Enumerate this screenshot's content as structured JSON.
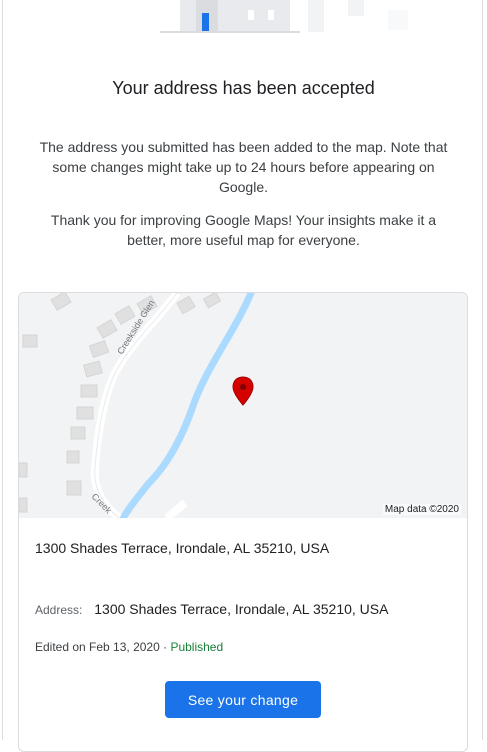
{
  "confirmation": {
    "title": "Your address has been accepted",
    "message": "The address you submitted has been added to the map. Note that some changes might take up to 24 hours before appearing on Google.",
    "thanks": "Thank you for improving Google Maps! Your insights make it a better, more useful map for everyone."
  },
  "map": {
    "street_label_1": "Creekside Glen",
    "street_label_2": "Creek",
    "attribution": "Map data ©2020",
    "pin_color": "#d50000"
  },
  "details": {
    "full_address": "1300 Shades Terrace, Irondale, AL 35210, USA",
    "address_label": "Address:",
    "address_value": "1300 Shades Terrace, Irondale, AL 35210, USA",
    "edited_text": "Edited on Feb 13, 2020 · ",
    "status": "Published"
  },
  "actions": {
    "see_change_label": "See your change"
  },
  "colors": {
    "accent": "#1a73e8",
    "published": "#188038",
    "water": "#aadaff"
  }
}
